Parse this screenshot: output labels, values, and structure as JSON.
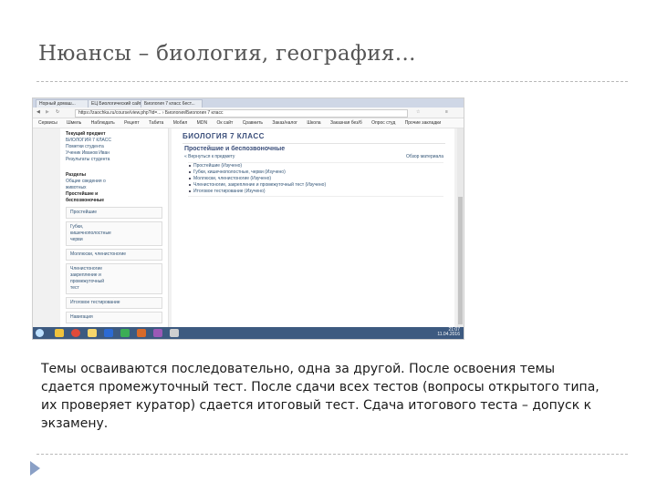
{
  "slide": {
    "title": "Нюансы – биология, география…",
    "body": "Темы осваиваются последовательно, одна за другой. После освоения темы сдается промежуточный тест. После сдачи всех тестов (вопросы открытого типа, их проверяет куратор) сдается итоговый тест. Сдача итогового теста – допуск к экзамену."
  },
  "browser": {
    "tabs": [
      "Норный домаш...",
      "ЕЦ Биологический сайт",
      "Биология 7 класс 6ест..."
    ],
    "address": "https://zaochka.ru/course/view.php?id=... › Биология/Биология 7 класс",
    "bookmarks": [
      "Сервисы",
      "Шмель",
      "Наблюдать",
      "Рецепт",
      "Табита",
      "Мобил",
      "MDN",
      "Ок сайт",
      "Сравнить",
      "Заказ/налог",
      "Школа",
      "Заказная без/б",
      "Опрос студ",
      "Прочие закладки"
    ]
  },
  "page": {
    "left_blocks": [
      {
        "heading": "Текущий предмет",
        "lines": [
          "БИОЛОГИЯ 7 КЛАСС",
          "Пометки студента",
          "Ученик Иванов Иван",
          "Результаты студента"
        ]
      },
      {
        "heading": "Разделы",
        "lines": [
          "Общие сведения о",
          "животных",
          "Простейшие и",
          "беспозвоночные"
        ]
      }
    ],
    "left_boxes": [
      [
        "Простейшие"
      ],
      [
        "Губки,",
        "кишечнополостные",
        "черви"
      ],
      [
        "Моллюски, членистоногие"
      ],
      [
        "Членистоногие",
        "закрепление и",
        "промежуточный",
        "тест"
      ],
      [
        "Итоговое тестирование"
      ],
      [
        "Навигация"
      ]
    ],
    "subject": "БИОЛОГИЯ 7 КЛАСС",
    "section_title": "Простейшие и беспозвоночные",
    "back_link": "« Вернуться к предмету",
    "stat_link": "Обзор материала",
    "topics": [
      "Простейшие (Изучено)",
      "Губки, кишечнополостные, черви (Изучено)",
      "Моллюски, членистоногие (Изучено)",
      "Членистоногие, закрепление и промежуточный тест (Изучено)",
      "Итоговое тестирование (Изучено)"
    ],
    "clock": {
      "time": "21:07",
      "date": "11.04.2016"
    }
  },
  "icons": {
    "taskbar": [
      "windows-start-icon",
      "explorer-icon",
      "chrome-icon",
      "file-icon",
      "word-icon",
      "media-icon",
      "paint-icon",
      "settings-icon",
      "app-icon"
    ],
    "nav": "next-slide-arrow-icon"
  },
  "colors": {
    "accent": "#3a4e7a",
    "nav_arrow": "#8aa0c6",
    "taskbar": "#3d5a80"
  }
}
